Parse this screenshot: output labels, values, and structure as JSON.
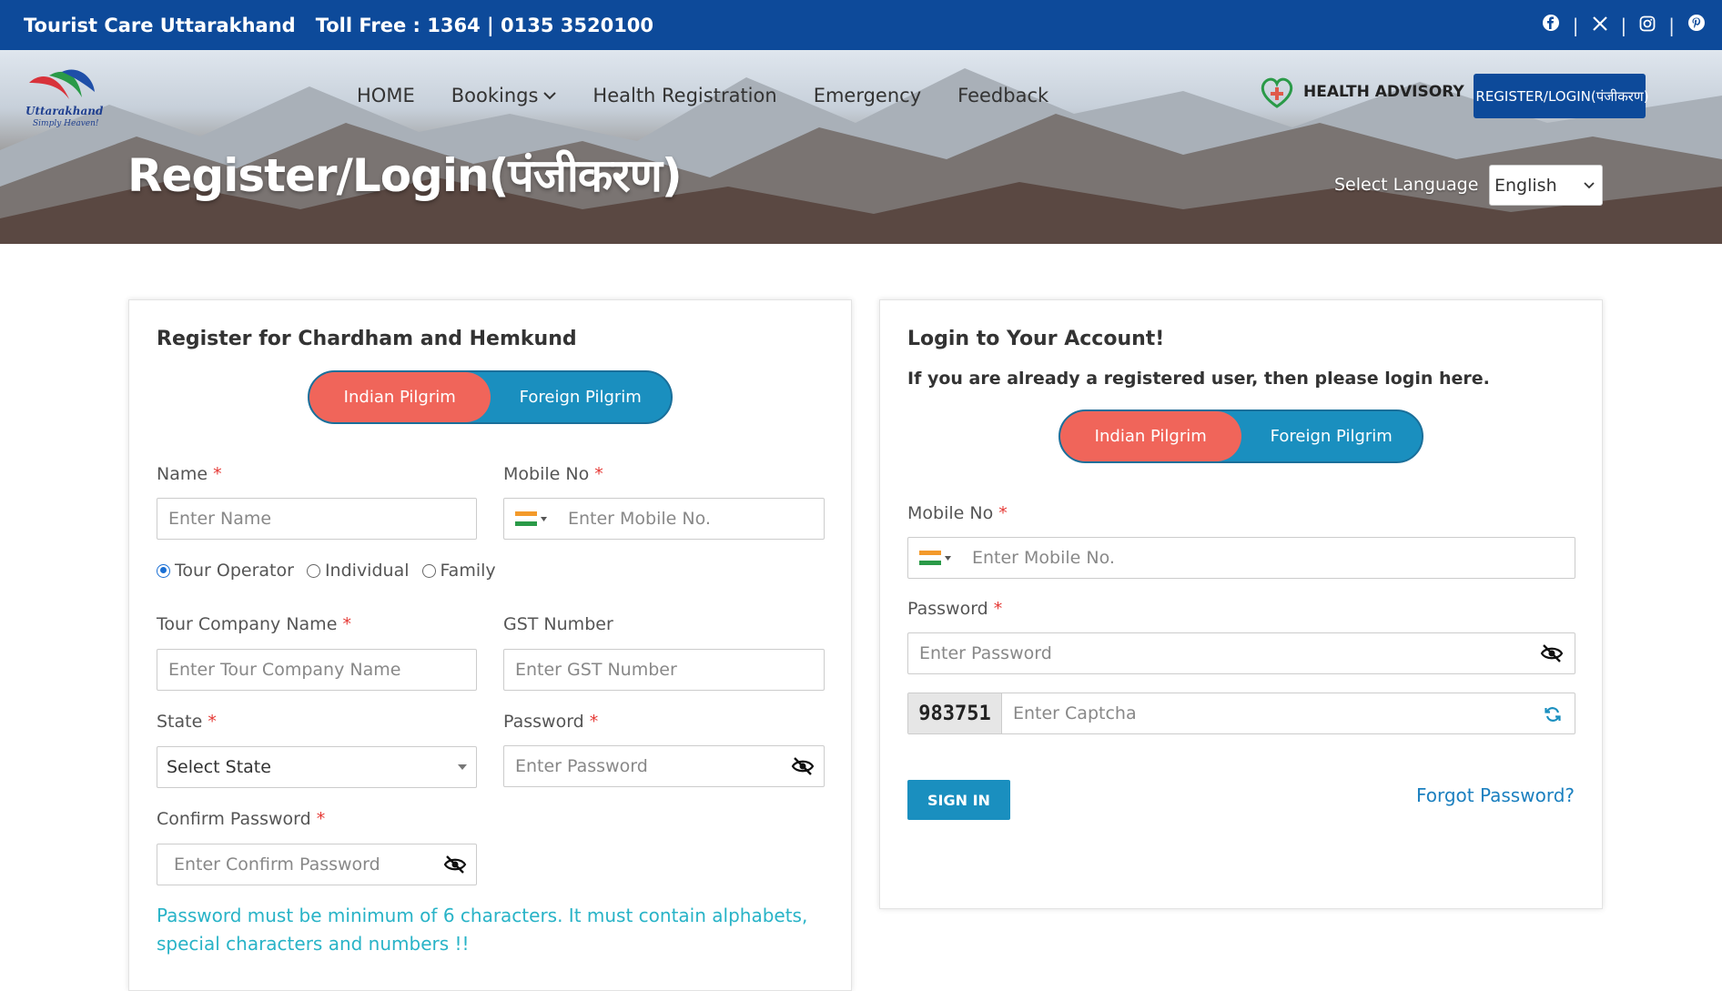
{
  "topbar": {
    "brand": "Tourist Care Uttarakhand",
    "toll_free": "Toll Free : 1364 | 0135 3520100",
    "socials": [
      "facebook-icon",
      "x-icon",
      "instagram-icon",
      "pinterest-icon"
    ],
    "separator": "|"
  },
  "header": {
    "logo_text": "Uttarakhand",
    "logo_tagline": "Simply Heaven!",
    "nav": [
      {
        "label": "HOME"
      },
      {
        "label": "Bookings"
      },
      {
        "label": "Health Registration"
      },
      {
        "label": "Emergency"
      },
      {
        "label": "Feedback"
      }
    ],
    "health_advisory": "HEALTH ADVISORY",
    "register_login_button": "REGISTER/LOGIN(पंजीकरण)",
    "page_title": "Register/Login(पंजीकरण)",
    "select_language_label": "Select Language",
    "language_selected": "English"
  },
  "register": {
    "heading": "Register for Chardham and Hemkund",
    "toggle": {
      "indian": "Indian Pilgrim",
      "foreign": "Foreign Pilgrim",
      "active": "indian"
    },
    "name_label": "Name",
    "name_placeholder": "Enter Name",
    "mobile_label": "Mobile No",
    "mobile_placeholder": "Enter  Mobile No.",
    "radio_options": [
      "Tour Operator",
      "Individual",
      "Family"
    ],
    "radio_selected": "Tour Operator",
    "company_label": "Tour Company Name",
    "company_placeholder": "Enter Tour Company Name",
    "gst_label": "GST Number",
    "gst_placeholder": "Enter GST Number",
    "state_label": "State",
    "state_value": "Select State",
    "password_label": "Password",
    "password_placeholder": "Enter  Password",
    "confirm_label": "Confirm Password",
    "confirm_placeholder": "Enter Confirm Password",
    "required_mark": "*",
    "note": "Password must be minimum of 6 characters. It must contain alphabets, special characters and numbers !!"
  },
  "login": {
    "heading": "Login to Your Account!",
    "subtitle": "If you are already a registered user, then please login here.",
    "toggle": {
      "indian": "Indian Pilgrim",
      "foreign": "Foreign Pilgrim",
      "active": "indian"
    },
    "mobile_label": "Mobile No",
    "mobile_placeholder": "Enter  Mobile No.",
    "password_label": "Password",
    "password_placeholder": "Enter  Password",
    "captcha_value": "983751",
    "captcha_placeholder": "Enter Captcha",
    "signin_button": "SIGN IN",
    "forgot_link": "Forgot Password?",
    "required_mark": "*"
  },
  "colors": {
    "primary_blue": "#0d4a9a",
    "teal": "#1a8fbf",
    "coral": "#f0655a",
    "note_cyan": "#28b3c7",
    "required_red": "#e53935"
  }
}
